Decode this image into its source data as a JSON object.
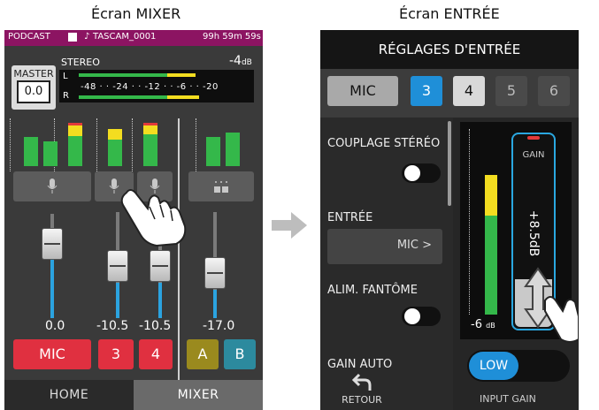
{
  "captions": {
    "mixer": "Écran MIXER",
    "entree": "Écran ENTRÉE"
  },
  "mixer": {
    "status": {
      "mode": "PODCAST",
      "file": "TASCAM_0001",
      "time": "99h 59m 59s"
    },
    "master": {
      "label": "MASTER",
      "value": "0.0",
      "mode": "STEREO",
      "level": "-4",
      "level_unit": "dB",
      "left_label": "L",
      "right_label": "R",
      "scale": "-48 · · -24 · · -12 · · -6 · · -20"
    },
    "channels": [
      {
        "name": "MIC",
        "value": "0.0",
        "color": "#e03040"
      },
      {
        "name": "3",
        "value": "-10.5",
        "color": "#e03040"
      },
      {
        "name": "4",
        "value": "-10.5",
        "color": "#e03040"
      },
      {
        "name": "A",
        "value": "-17.0",
        "color": "#9a8a1e"
      },
      {
        "name": "B",
        "value": "",
        "color": "#2c8a9e"
      }
    ],
    "tabs": {
      "home": "HOME",
      "mixer": "MIXER"
    }
  },
  "entree": {
    "title": "RÉGLAGES D'ENTRÉE",
    "tabs": [
      "MIC",
      "3",
      "4",
      "5",
      "6"
    ],
    "settings": {
      "couplage": "COUPLAGE STÉRÉO",
      "entree": "ENTRÉE",
      "entree_value": "MIC >",
      "fantome": "ALIM. FANTÔME",
      "gain_auto": "GAIN AUTO"
    },
    "gain": {
      "label": "GAIN",
      "value": "+8.5dB",
      "meter_min": "-6",
      "meter_unit": "dB"
    },
    "low_toggle": "LOW",
    "retour": "RETOUR",
    "input_gain": "INPUT GAIN"
  }
}
